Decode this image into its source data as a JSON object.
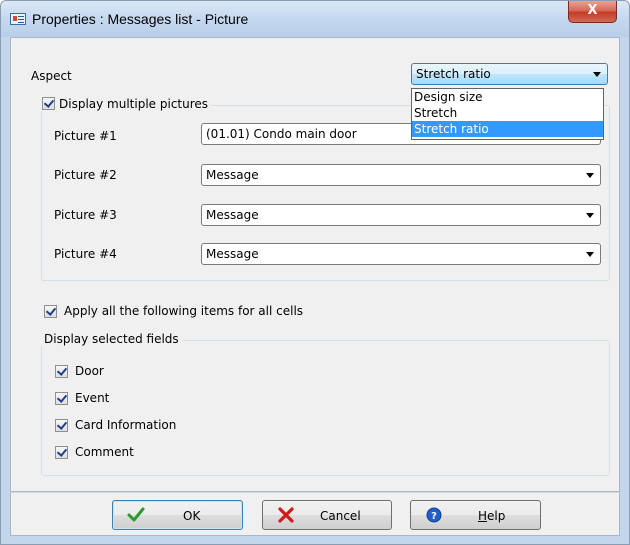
{
  "window": {
    "title": "Properties : Messages list - Picture",
    "close_glyph": "X",
    "icon": "app-window-icon"
  },
  "aspect": {
    "label": "Aspect",
    "selected": "Stretch ratio",
    "options": [
      "Design size",
      "Stretch",
      "Stretch ratio"
    ],
    "open": true
  },
  "multiple_pictures": {
    "checkbox_label": "Display multiple pictures",
    "checked": true,
    "pictures": [
      {
        "label": "Picture #1",
        "value": "(01.01) Condo main door"
      },
      {
        "label": "Picture #2",
        "value": "Message"
      },
      {
        "label": "Picture #3",
        "value": "Message"
      },
      {
        "label": "Picture #4",
        "value": "Message"
      }
    ]
  },
  "apply_all": {
    "label": "Apply all the following items for all cells",
    "checked": true
  },
  "fields": {
    "group_title": "Display selected fields",
    "items": [
      {
        "label": "Door",
        "checked": true
      },
      {
        "label": "Event",
        "checked": true
      },
      {
        "label": "Card Information",
        "checked": true
      },
      {
        "label": "Comment",
        "checked": true
      }
    ]
  },
  "buttons": {
    "ok": "OK",
    "cancel": "Cancel",
    "help_prefix": "H",
    "help_rest": "elp"
  },
  "colors": {
    "accent": "#3399ff",
    "ok_check": "#2e9a2e",
    "cancel_x": "#d11a1a",
    "help_blue": "#1f5fc8"
  }
}
